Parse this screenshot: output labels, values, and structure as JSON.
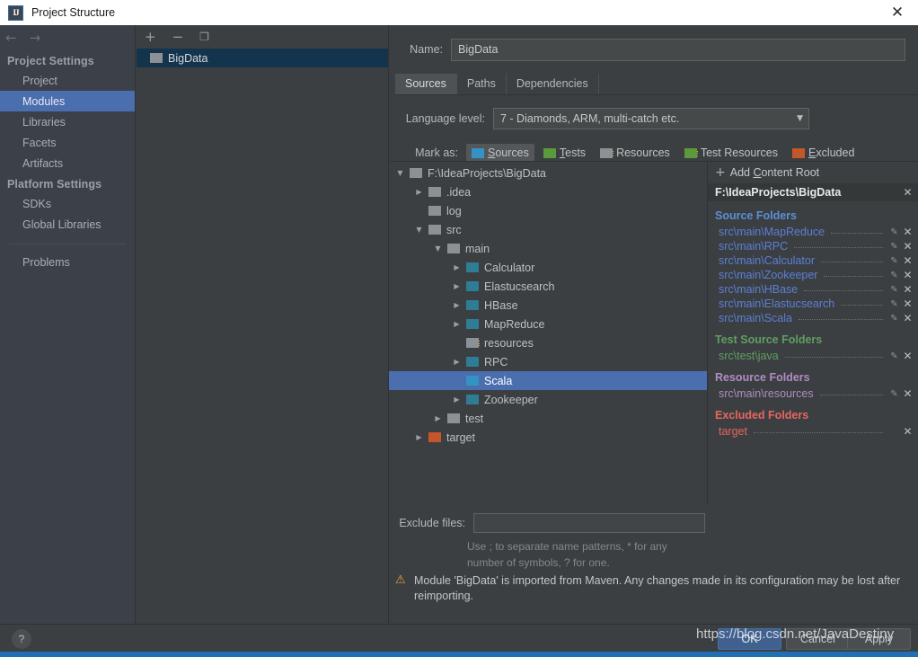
{
  "window": {
    "title": "Project Structure",
    "icon": "intellij-idea-icon",
    "close_label": "✕"
  },
  "nav": {
    "back": "←",
    "forward": "→"
  },
  "sidebar": {
    "groups": [
      {
        "title": "Project Settings",
        "items": [
          {
            "label": "Project",
            "selected": false
          },
          {
            "label": "Modules",
            "selected": true
          },
          {
            "label": "Libraries",
            "selected": false
          },
          {
            "label": "Facets",
            "selected": false
          },
          {
            "label": "Artifacts",
            "selected": false
          }
        ]
      },
      {
        "title": "Platform Settings",
        "items": [
          {
            "label": "SDKs",
            "selected": false
          },
          {
            "label": "Global Libraries",
            "selected": false
          }
        ]
      }
    ],
    "problems_label": "Problems"
  },
  "modules_panel": {
    "toolbar": {
      "add": "+",
      "remove": "−",
      "copy": "❐"
    },
    "items": [
      {
        "label": "BigData",
        "selected": true
      }
    ]
  },
  "form": {
    "name_label": "Name:",
    "name_value": "BigData",
    "name_placeholder": "",
    "tabs": [
      {
        "label": "Sources",
        "active": true
      },
      {
        "label": "Paths",
        "active": false
      },
      {
        "label": "Dependencies",
        "active": false
      }
    ],
    "language_level_label": "Language level:",
    "language_level_value": "7 - Diamonds, ARM, multi-catch etc.",
    "caret": "▼",
    "mark_as_label": "Mark as:",
    "mark_buttons": [
      {
        "label": "Sources",
        "mnemonic": "S",
        "rest": "ources",
        "color": "f-blue",
        "icon": "folder-sources-icon",
        "active": true,
        "resource": false
      },
      {
        "label": "Tests",
        "mnemonic": "T",
        "rest": "ests",
        "color": "f-green",
        "icon": "folder-tests-icon",
        "active": false,
        "resource": false
      },
      {
        "label": "Resources",
        "mnemonic": "",
        "rest": "Resources",
        "color": "f-gray",
        "icon": "folder-resources-icon",
        "active": false,
        "resource": true
      },
      {
        "label": "Test Resources",
        "mnemonic": "",
        "rest": "Test Resources",
        "color": "f-green",
        "icon": "folder-test-resources-icon",
        "active": false,
        "resource": true
      },
      {
        "label": "Excluded",
        "mnemonic": "E",
        "rest": "xcluded",
        "color": "f-orange",
        "icon": "folder-excluded-icon",
        "active": false,
        "resource": false
      }
    ]
  },
  "tree": {
    "rows": [
      {
        "label": "F:\\IdeaProjects\\BigData",
        "indent": 0,
        "arrow": "▼",
        "icon": "f-gray",
        "resource": false,
        "selected": false
      },
      {
        "label": ".idea",
        "indent": 1,
        "arrow": "▶",
        "icon": "f-gray",
        "resource": false,
        "selected": false
      },
      {
        "label": "log",
        "indent": 1,
        "arrow": "",
        "icon": "f-gray",
        "resource": false,
        "selected": false
      },
      {
        "label": "src",
        "indent": 1,
        "arrow": "▼",
        "icon": "f-gray",
        "resource": false,
        "selected": false
      },
      {
        "label": "main",
        "indent": 2,
        "arrow": "▼",
        "icon": "f-gray",
        "resource": false,
        "selected": false
      },
      {
        "label": "Calculator",
        "indent": 3,
        "arrow": "▶",
        "icon": "f-teal",
        "resource": false,
        "selected": false
      },
      {
        "label": "Elastucsearch",
        "indent": 3,
        "arrow": "▶",
        "icon": "f-teal",
        "resource": false,
        "selected": false
      },
      {
        "label": "HBase",
        "indent": 3,
        "arrow": "▶",
        "icon": "f-teal",
        "resource": false,
        "selected": false
      },
      {
        "label": "MapReduce",
        "indent": 3,
        "arrow": "▶",
        "icon": "f-teal",
        "resource": false,
        "selected": false
      },
      {
        "label": "resources",
        "indent": 3,
        "arrow": "",
        "icon": "f-gray",
        "resource": true,
        "selected": false
      },
      {
        "label": "RPC",
        "indent": 3,
        "arrow": "▶",
        "icon": "f-teal",
        "resource": false,
        "selected": false
      },
      {
        "label": "Scala",
        "indent": 3,
        "arrow": "",
        "icon": "f-blue",
        "resource": false,
        "selected": true
      },
      {
        "label": "Zookeeper",
        "indent": 3,
        "arrow": "▶",
        "icon": "f-teal",
        "resource": false,
        "selected": false
      },
      {
        "label": "test",
        "indent": 2,
        "arrow": "▶",
        "icon": "f-gray",
        "resource": false,
        "selected": false
      },
      {
        "label": "target",
        "indent": 1,
        "arrow": "▶",
        "icon": "f-orange",
        "resource": false,
        "selected": false
      }
    ]
  },
  "content_roots": {
    "add_label_prefix": "Add ",
    "add_label_mnemonic": "C",
    "add_label_rest": "ontent Root",
    "plus": "+",
    "root_path": "F:\\IdeaProjects\\BigData",
    "root_remove": "✕",
    "sections": [
      {
        "title": "Source Folders",
        "kind": "src",
        "entries": [
          {
            "path": "src\\main\\MapReduce",
            "editable": true
          },
          {
            "path": "src\\main\\RPC",
            "editable": true
          },
          {
            "path": "src\\main\\Calculator",
            "editable": true
          },
          {
            "path": "src\\main\\Zookeeper",
            "editable": true
          },
          {
            "path": "src\\main\\HBase",
            "editable": true
          },
          {
            "path": "src\\main\\Elastucsearch",
            "editable": true
          },
          {
            "path": "src\\main\\Scala",
            "editable": true
          }
        ]
      },
      {
        "title": "Test Source Folders",
        "kind": "test",
        "entries": [
          {
            "path": "src\\test\\java",
            "editable": true
          }
        ]
      },
      {
        "title": "Resource Folders",
        "kind": "res",
        "entries": [
          {
            "path": "src\\main\\resources",
            "editable": true
          }
        ]
      },
      {
        "title": "Excluded Folders",
        "kind": "exc",
        "entries": [
          {
            "path": "target",
            "editable": false
          }
        ]
      }
    ],
    "pencil": "✎",
    "remove": "✕"
  },
  "exclude": {
    "label": "Exclude files:",
    "value": "",
    "placeholder": "",
    "hint_line1": "Use ; to separate name patterns, * for any",
    "hint_line2": "number of symbols, ? for one."
  },
  "warning": {
    "icon": "⚠",
    "text": "Module 'BigData' is imported from Maven. Any changes made in its configuration may be lost after reimporting."
  },
  "footer": {
    "help": "?",
    "ok": "OK",
    "cancel": "Cancel",
    "apply": "Apply"
  },
  "watermark": {
    "text": "https://blog.csdn.net/JavaDestiny"
  }
}
